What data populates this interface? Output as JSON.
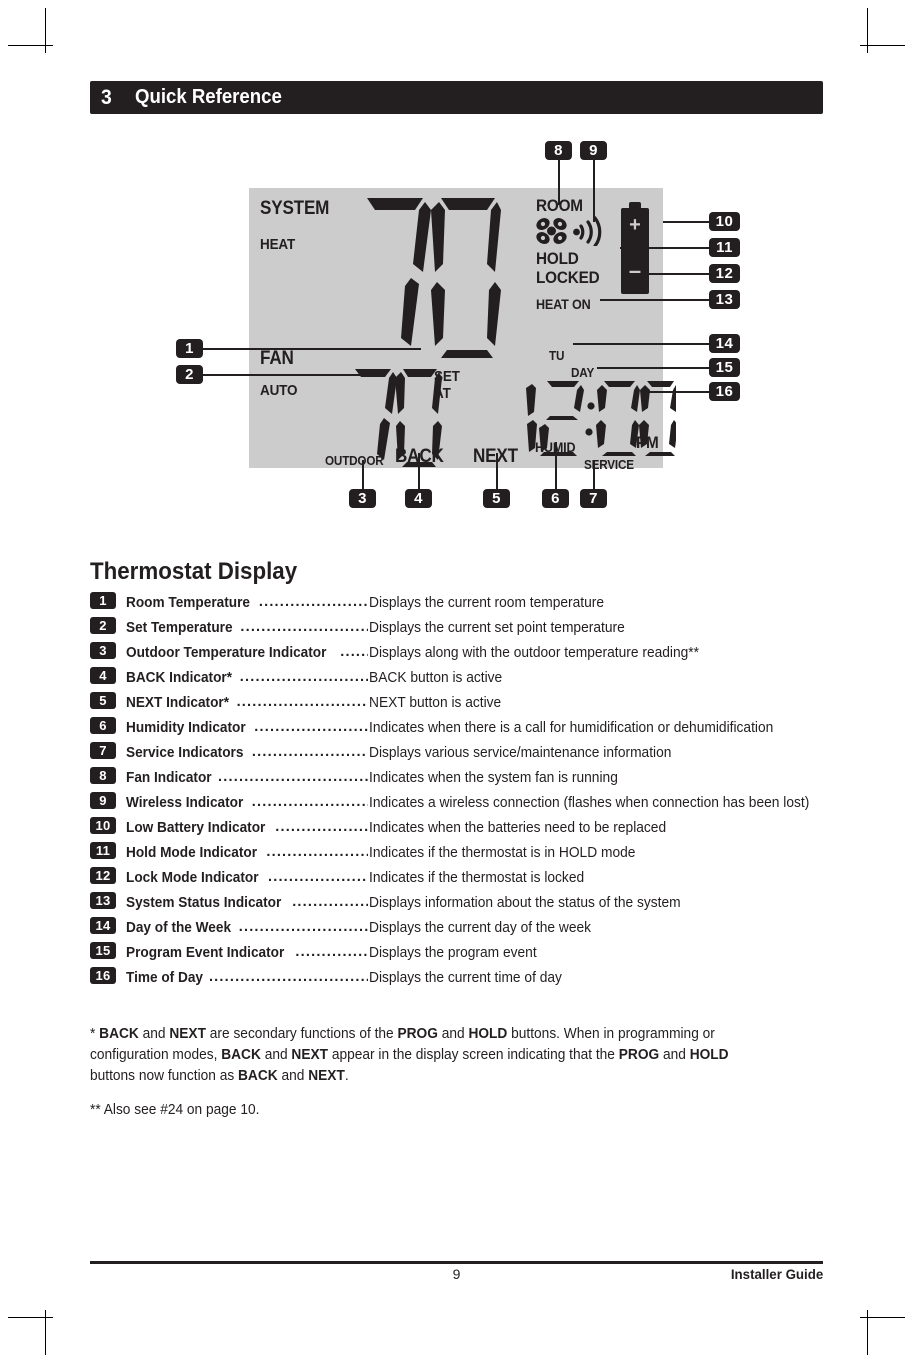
{
  "page": {
    "chapter_number": "3",
    "chapter_title": "Quick Reference",
    "section_title": "Thermostat Display",
    "page_number": "9",
    "footer_right": "Installer Guide"
  },
  "colors": {
    "ink": "#231f20",
    "lcd_background": "#cccccc",
    "paper": "#ffffff"
  },
  "lcd": {
    "system_label": "SYSTEM",
    "mode_label": "HEAT",
    "fan_label": "FAN",
    "fan_mode_label": "AUTO",
    "room_temperature": "70",
    "room_label": "ROOM",
    "set_temperature": "70",
    "set_label": "SET",
    "at_label": "AT",
    "outdoor_label": "OUTDOOR",
    "back_label": "BACK",
    "next_label": "NEXT",
    "hold_label": "HOLD",
    "locked_label": "LOCKED",
    "heat_on_label": "HEAT ON",
    "day_of_week": "TU",
    "day_label": "DAY",
    "time_of_day": "12:00",
    "meridiem": "PM",
    "humid_label": "HUMID",
    "service_label": "SERVICE",
    "battery_plus": "+",
    "battery_minus": "–",
    "fan_icon_name": "fan-blade-icon",
    "wireless_icon_name": "wireless-signal-icon",
    "battery_icon_name": "battery-icon"
  },
  "callouts": {
    "c1": "1",
    "c2": "2",
    "c3": "3",
    "c4": "4",
    "c5": "5",
    "c6": "6",
    "c7": "7",
    "c8": "8",
    "c9": "9",
    "c10": "10",
    "c11": "11",
    "c12": "12",
    "c13": "13",
    "c14": "14",
    "c15": "15",
    "c16": "16"
  },
  "legend": {
    "dots": "......................................................................",
    "items": [
      {
        "num": "1",
        "term": "Room Temperature",
        "desc": "Displays the current room temperature"
      },
      {
        "num": "2",
        "term": "Set Temperature",
        "desc": "Displays the current set point temperature"
      },
      {
        "num": "3",
        "term": "Outdoor Temperature Indicator",
        "desc": "Displays along with the outdoor temperature reading**"
      },
      {
        "num": "4",
        "term": "BACK Indicator*",
        "desc": "BACK button is active"
      },
      {
        "num": "5",
        "term": "NEXT Indicator*",
        "desc": "NEXT button is active"
      },
      {
        "num": "6",
        "term": "Humidity Indicator",
        "desc": "Indicates when there is a call for humidification or dehumidification"
      },
      {
        "num": "7",
        "term": "Service Indicators",
        "desc": "Displays various service/maintenance information"
      },
      {
        "num": "8",
        "term": "Fan Indicator",
        "desc": "Indicates when the system fan is running"
      },
      {
        "num": "9",
        "term": "Wireless Indicator",
        "desc": "Indicates a wireless connection (flashes when connection has been lost)"
      },
      {
        "num": "10",
        "term": "Low Battery Indicator",
        "desc": "Indicates when the batteries need to be replaced"
      },
      {
        "num": "11",
        "term": "Hold Mode Indicator",
        "desc": "Indicates if the thermostat is in HOLD mode"
      },
      {
        "num": "12",
        "term": "Lock Mode Indicator",
        "desc": "Indicates if the thermostat is locked"
      },
      {
        "num": "13",
        "term": "System Status Indicator",
        "desc": "Displays information about the status of the system"
      },
      {
        "num": "14",
        "term": "Day of the Week",
        "desc": "Displays the current day of the week"
      },
      {
        "num": "15",
        "term": "Program Event Indicator",
        "desc": "Displays the program event"
      },
      {
        "num": "16",
        "term": "Time of Day",
        "desc": "Displays the current time of day"
      }
    ]
  },
  "footnotes": {
    "note1_html": "* <b>BACK</b> and <b>NEXT</b> are secondary functions of the <b>PROG</b> and <b>HOLD</b> buttons. When in programming or configuration modes, <b>BACK</b> and <b>NEXT</b> appear in the display screen indicating that the <b>PROG</b> and <b>HOLD</b> buttons now function as <b>BACK</b> and <b>NEXT</b>.",
    "note2_html": "** Also see #24 on page 10."
  }
}
